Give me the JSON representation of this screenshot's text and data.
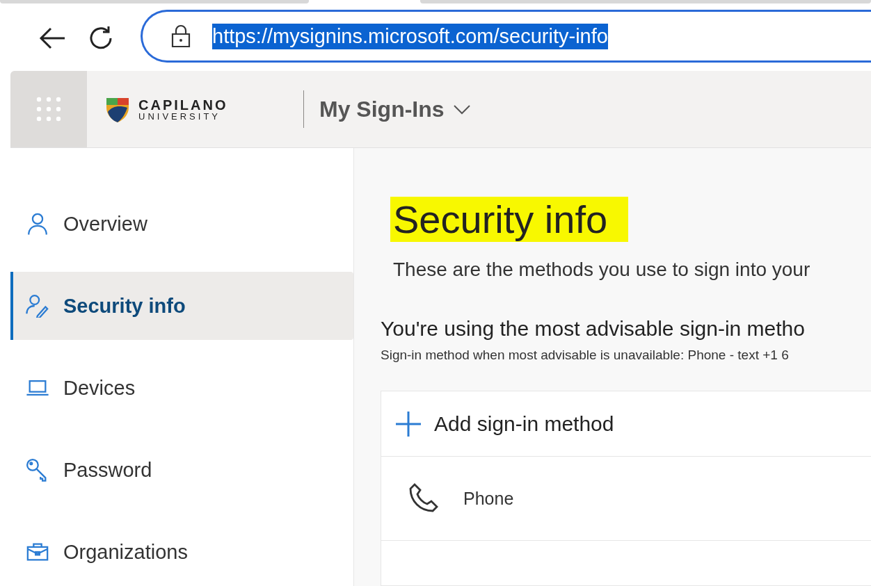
{
  "browser": {
    "url": "https://mysignins.microsoft.com/security-info",
    "url_selected": true
  },
  "header": {
    "logo_top": "CAPILANO",
    "logo_bottom": "UNIVERSITY",
    "app_title": "My Sign-Ins"
  },
  "sidebar": {
    "items": [
      {
        "label": "Overview",
        "kind": "overview",
        "selected": false
      },
      {
        "label": "Security info",
        "kind": "security",
        "selected": true
      },
      {
        "label": "Devices",
        "kind": "devices",
        "selected": false
      },
      {
        "label": "Password",
        "kind": "password",
        "selected": false
      },
      {
        "label": "Organizations",
        "kind": "organizations",
        "selected": false
      }
    ]
  },
  "main": {
    "title": "Security info",
    "title_highlighted": true,
    "description": "These are the methods you use to sign into your",
    "advisable_heading": "You're using the most advisable sign-in metho",
    "fallback_note": "Sign-in method when most advisable is unavailable: Phone - text +1 6",
    "add_method": "Add sign-in method",
    "methods": [
      {
        "label": "Phone",
        "kind": "phone"
      }
    ]
  }
}
